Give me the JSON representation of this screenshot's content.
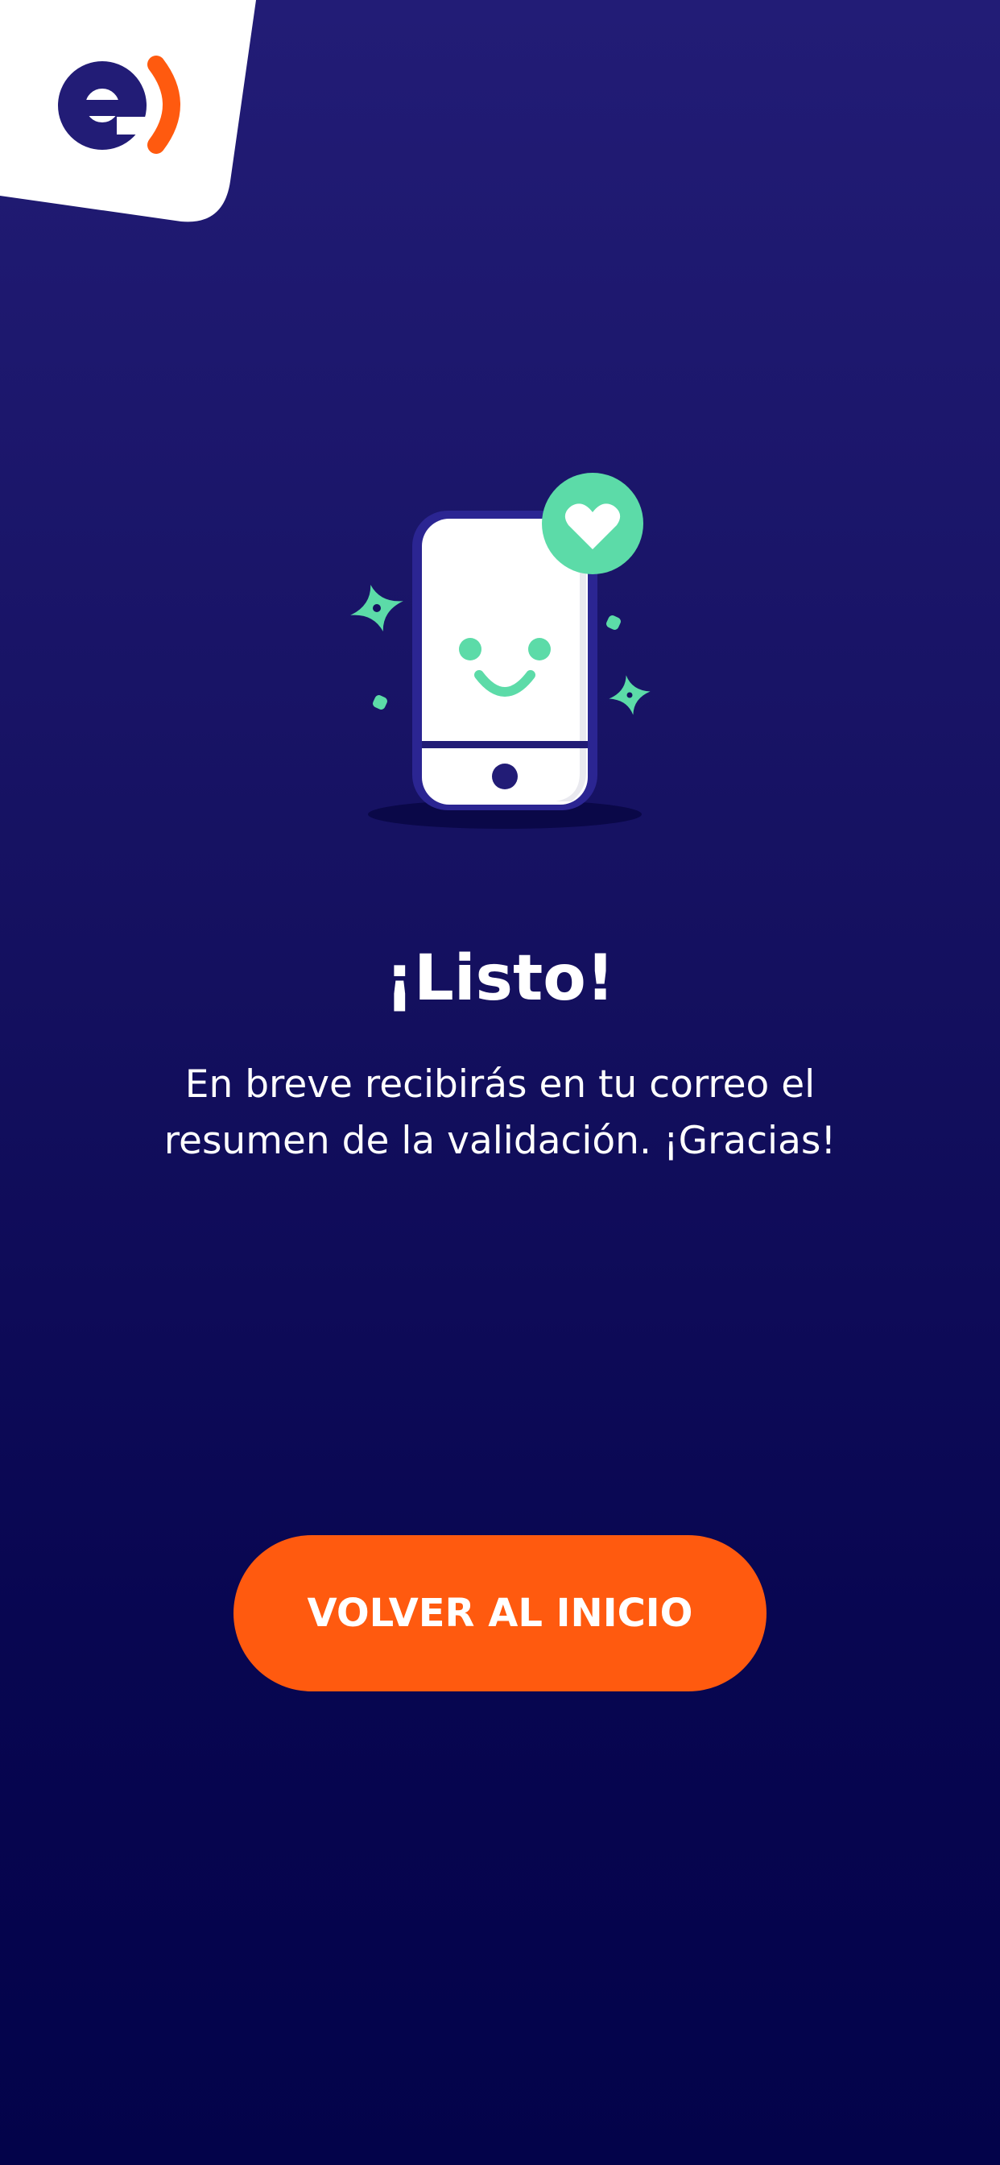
{
  "brand": {
    "logo_icon": "entel-logo-icon",
    "primary_color": "#221c76",
    "accent_color": "#ff5a0f",
    "success_color": "#5cdba8"
  },
  "success": {
    "illustration_icon": "happy-phone-heart-icon",
    "title": "¡Listo!",
    "message_line1": "En breve recibirás en tu correo el",
    "message_line2": "resumen de la validación. ¡Gracias!"
  },
  "actions": {
    "home_button_label": "VOLVER AL INICIO"
  }
}
